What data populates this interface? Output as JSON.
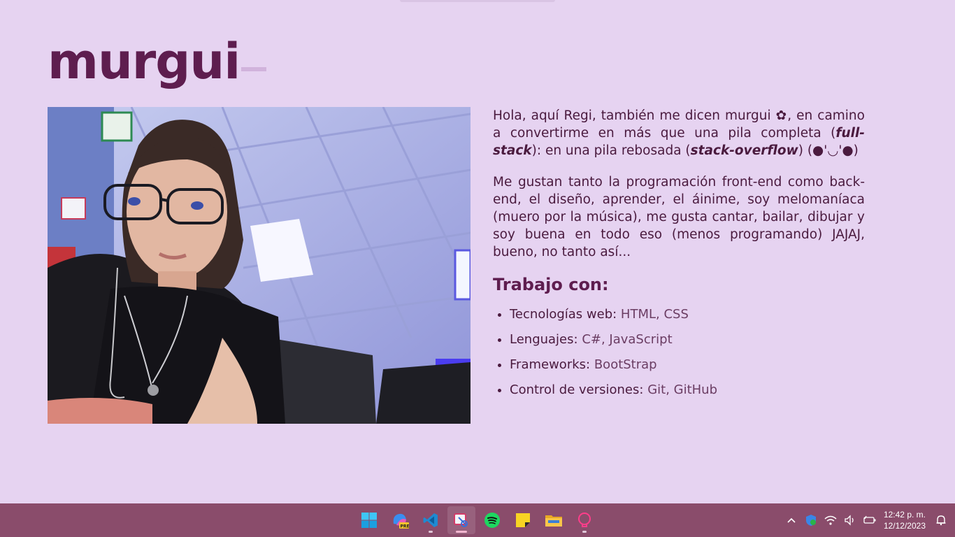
{
  "site": {
    "logo_text": "murgui"
  },
  "about": {
    "p1_a": "Hola, aquí Regi, también me dicen murgui ",
    "p1_flower": "✿",
    "p1_b": ", en camino a convertirme en más que una pila completa (",
    "p1_fullstack": "full-stack",
    "p1_c": "): en una pila rebosada (",
    "p1_stackoverflow": "stack-overflow",
    "p1_d": ") (●'◡'●)",
    "p2": "Me gustan tanto la programación front-end como back-end, el diseño, aprender, el áinime, soy melomaníaca (muero por la música), me gusta cantar, bailar, dibujar y soy buena en todo eso (menos programando) JAJAJ, bueno, no tanto así..."
  },
  "skills": {
    "title": "Trabajo con:",
    "items": [
      {
        "label": "Tecnologías web:",
        "value": "HTML, CSS"
      },
      {
        "label": "Lenguajes:",
        "value": "C#, JavaScript"
      },
      {
        "label": "Frameworks:",
        "value": "BootStrap"
      },
      {
        "label": "Control de versiones:",
        "value": "Git, GitHub"
      }
    ]
  },
  "taskbar": {
    "apps": [
      {
        "name": "start-button",
        "icon": "windows-icon"
      },
      {
        "name": "copilot-preview",
        "icon": "copilot-pre-icon"
      },
      {
        "name": "vscode",
        "icon": "vscode-icon"
      },
      {
        "name": "snipping-tool",
        "icon": "snipping-tool-icon"
      },
      {
        "name": "spotify",
        "icon": "spotify-icon"
      },
      {
        "name": "sticky-notes",
        "icon": "sticky-notes-icon"
      },
      {
        "name": "file-explorer",
        "icon": "folder-icon"
      },
      {
        "name": "app-pink",
        "icon": "pink-lightbulb-icon"
      }
    ],
    "clock": {
      "time": "12:42 p. m.",
      "date": "12/12/2023"
    }
  },
  "colors": {
    "background": "#e6d3f1",
    "primary_text": "#5e1d4f",
    "taskbar": "#8a4c6b"
  }
}
